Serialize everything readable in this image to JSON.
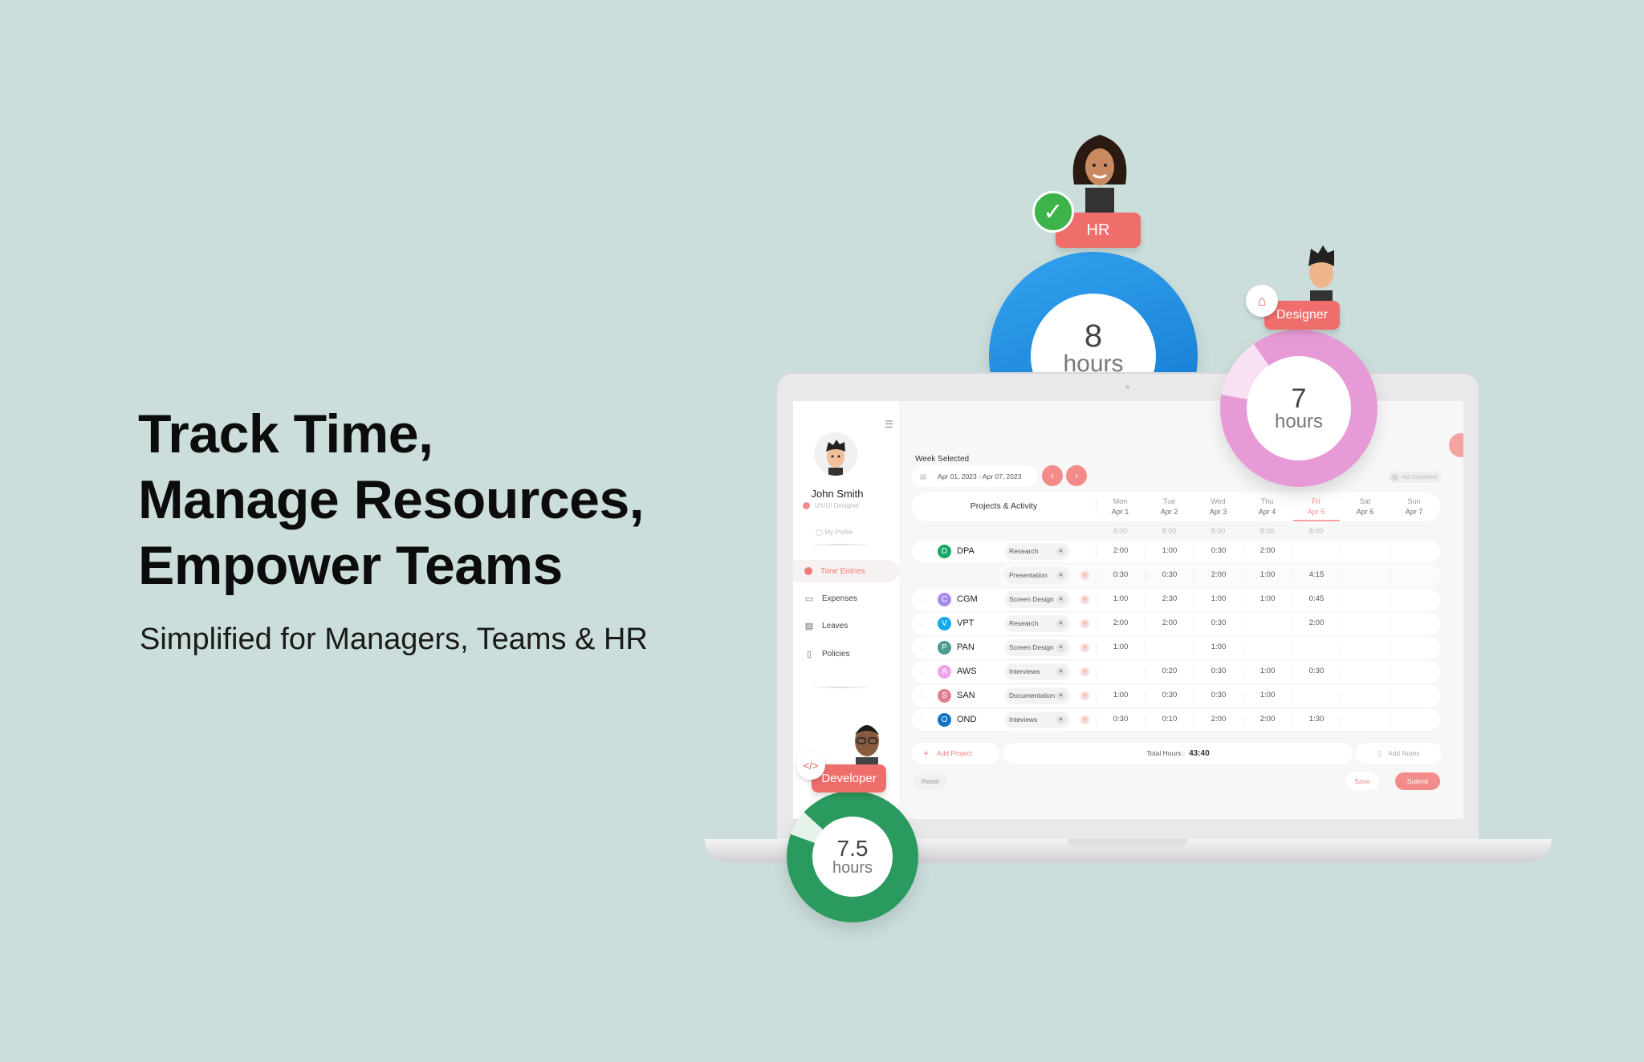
{
  "hero": {
    "line1": "Track Time,",
    "line2": "Manage Resources,",
    "line3": "Empower Teams",
    "subtitle": "Simplified for Managers, Teams & HR"
  },
  "colors": {
    "background": "#cbdedc",
    "accent": "#f07a78",
    "hr_ring": "#1a8ae0",
    "designer_ring": "#e79bd6",
    "developer_ring": "#2b9a5e"
  },
  "roles": [
    {
      "label": "HR",
      "hours": "8",
      "unit": "hours",
      "icon": "check-icon"
    },
    {
      "label": "Designer",
      "hours": "7",
      "unit": "hours",
      "icon": "home-icon"
    },
    {
      "label": "Developer",
      "hours": "7.5",
      "unit": "hours",
      "icon": "code-icon"
    }
  ],
  "sidebar": {
    "name": "John Smith",
    "role": "UX/UI Designer",
    "profile": "My Profile",
    "items": [
      {
        "label": "Time Entries",
        "icon": "clock-icon",
        "active": true
      },
      {
        "label": "Expenses",
        "icon": "receipt-icon"
      },
      {
        "label": "Leaves",
        "icon": "calendar-icon"
      },
      {
        "label": "Policies",
        "icon": "document-icon"
      }
    ]
  },
  "week": {
    "label": "Week Selected",
    "range": "Apr 01, 2023 - Apr 07, 2023",
    "status": "Not Submitted"
  },
  "table": {
    "title": "Projects & Activity",
    "days": [
      {
        "d": "Mon",
        "date": "Apr 1"
      },
      {
        "d": "Tue",
        "date": "Apr 2"
      },
      {
        "d": "Wed",
        "date": "Apr 3"
      },
      {
        "d": "Thu",
        "date": "Apr 4"
      },
      {
        "d": "Fri",
        "date": "Apr 5",
        "today": true
      },
      {
        "d": "Sat",
        "date": "Apr 6"
      },
      {
        "d": "Sun",
        "date": "Apr 7"
      }
    ],
    "expected": [
      "8:00",
      "8:00",
      "8:00",
      "8:00",
      "8:00",
      "",
      ""
    ],
    "rows": [
      {
        "letter": "D",
        "project": "DPA",
        "color": "#1aa763",
        "activity": "Research",
        "hours": [
          "2:00",
          "1:00",
          "0:30",
          "2:00",
          "",
          "",
          ""
        ]
      },
      {
        "letter": "",
        "project": "",
        "color": "",
        "activity": "Presentation",
        "hours": [
          "0:30",
          "0:30",
          "2:00",
          "1:00",
          "4:15",
          "",
          ""
        ]
      },
      {
        "letter": "C",
        "project": "CGM",
        "color": "#a58af0",
        "activity": "Screen Design",
        "hours": [
          "1:00",
          "2:30",
          "1:00",
          "1:00",
          "0:45",
          "",
          ""
        ]
      },
      {
        "letter": "V",
        "project": "VPT",
        "color": "#12a9f0",
        "activity": "Research",
        "hours": [
          "2:00",
          "2:00",
          "0:30",
          "",
          "2:00",
          "",
          ""
        ]
      },
      {
        "letter": "P",
        "project": "PAN",
        "color": "#4b9a94",
        "activity": "Screen Design",
        "hours": [
          "1:00",
          "",
          "1:00",
          "",
          "",
          "",
          ""
        ]
      },
      {
        "letter": "A",
        "project": "AWS",
        "color": "#efa3e8",
        "activity": "Interviews",
        "hours": [
          "",
          "0:20",
          "0:30",
          "1:00",
          "0:30",
          "",
          ""
        ]
      },
      {
        "letter": "S",
        "project": "SAN",
        "color": "#e0808f",
        "activity": "Documentation",
        "hours": [
          "1:00",
          "0:30",
          "0:30",
          "1:00",
          "",
          "",
          ""
        ]
      },
      {
        "letter": "O",
        "project": "OND",
        "color": "#0f74c4",
        "activity": "Inteviews",
        "hours": [
          "0:30",
          "0:10",
          "2:00",
          "2:00",
          "1:30",
          "",
          ""
        ]
      }
    ]
  },
  "footer": {
    "add_project": "Add Project",
    "total_label": "Total Hours :",
    "total": "43:40",
    "add_notes": "Add Notes",
    "reset": "Reset",
    "save": "Save",
    "submit": "Submit"
  }
}
